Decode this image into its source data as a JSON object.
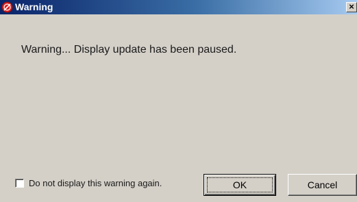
{
  "dialog": {
    "title": "Warning",
    "title_icon": "stop-icon",
    "close_glyph": "×",
    "message": "Warning... Display update has been paused.",
    "checkbox_label": "Do not display this warning again.",
    "checkbox_checked": false,
    "ok_label": "OK",
    "cancel_label": "Cancel"
  },
  "colors": {
    "titlebar_start": "#0a246a",
    "titlebar_end": "#a6caf0",
    "icon_red": "#e02020",
    "face": "#d4d0c8"
  }
}
